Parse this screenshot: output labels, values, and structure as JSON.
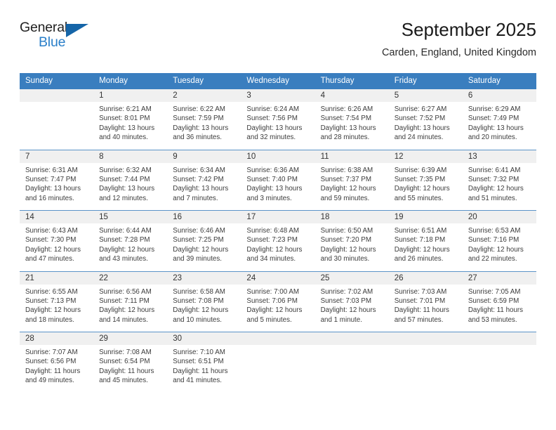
{
  "brand": {
    "name_part1": "General",
    "name_part2": "Blue",
    "flag_icon": "brand-flag-icon",
    "accent_color": "#1565a8"
  },
  "header": {
    "title": "September 2025",
    "location": "Carden, England, United Kingdom"
  },
  "theme": {
    "header_blue": "#3a7ebf",
    "separator_blue": "#5b93c8",
    "daynum_band": "#f0f0f0"
  },
  "columns": [
    "Sunday",
    "Monday",
    "Tuesday",
    "Wednesday",
    "Thursday",
    "Friday",
    "Saturday"
  ],
  "weeks": [
    {
      "days": [
        {
          "num": "",
          "sunrise": "",
          "sunset": "",
          "daylight1": "",
          "daylight2": ""
        },
        {
          "num": "1",
          "sunrise": "Sunrise: 6:21 AM",
          "sunset": "Sunset: 8:01 PM",
          "daylight1": "Daylight: 13 hours",
          "daylight2": "and 40 minutes."
        },
        {
          "num": "2",
          "sunrise": "Sunrise: 6:22 AM",
          "sunset": "Sunset: 7:59 PM",
          "daylight1": "Daylight: 13 hours",
          "daylight2": "and 36 minutes."
        },
        {
          "num": "3",
          "sunrise": "Sunrise: 6:24 AM",
          "sunset": "Sunset: 7:56 PM",
          "daylight1": "Daylight: 13 hours",
          "daylight2": "and 32 minutes."
        },
        {
          "num": "4",
          "sunrise": "Sunrise: 6:26 AM",
          "sunset": "Sunset: 7:54 PM",
          "daylight1": "Daylight: 13 hours",
          "daylight2": "and 28 minutes."
        },
        {
          "num": "5",
          "sunrise": "Sunrise: 6:27 AM",
          "sunset": "Sunset: 7:52 PM",
          "daylight1": "Daylight: 13 hours",
          "daylight2": "and 24 minutes."
        },
        {
          "num": "6",
          "sunrise": "Sunrise: 6:29 AM",
          "sunset": "Sunset: 7:49 PM",
          "daylight1": "Daylight: 13 hours",
          "daylight2": "and 20 minutes."
        }
      ]
    },
    {
      "days": [
        {
          "num": "7",
          "sunrise": "Sunrise: 6:31 AM",
          "sunset": "Sunset: 7:47 PM",
          "daylight1": "Daylight: 13 hours",
          "daylight2": "and 16 minutes."
        },
        {
          "num": "8",
          "sunrise": "Sunrise: 6:32 AM",
          "sunset": "Sunset: 7:44 PM",
          "daylight1": "Daylight: 13 hours",
          "daylight2": "and 12 minutes."
        },
        {
          "num": "9",
          "sunrise": "Sunrise: 6:34 AM",
          "sunset": "Sunset: 7:42 PM",
          "daylight1": "Daylight: 13 hours",
          "daylight2": "and 7 minutes."
        },
        {
          "num": "10",
          "sunrise": "Sunrise: 6:36 AM",
          "sunset": "Sunset: 7:40 PM",
          "daylight1": "Daylight: 13 hours",
          "daylight2": "and 3 minutes."
        },
        {
          "num": "11",
          "sunrise": "Sunrise: 6:38 AM",
          "sunset": "Sunset: 7:37 PM",
          "daylight1": "Daylight: 12 hours",
          "daylight2": "and 59 minutes."
        },
        {
          "num": "12",
          "sunrise": "Sunrise: 6:39 AM",
          "sunset": "Sunset: 7:35 PM",
          "daylight1": "Daylight: 12 hours",
          "daylight2": "and 55 minutes."
        },
        {
          "num": "13",
          "sunrise": "Sunrise: 6:41 AM",
          "sunset": "Sunset: 7:32 PM",
          "daylight1": "Daylight: 12 hours",
          "daylight2": "and 51 minutes."
        }
      ]
    },
    {
      "days": [
        {
          "num": "14",
          "sunrise": "Sunrise: 6:43 AM",
          "sunset": "Sunset: 7:30 PM",
          "daylight1": "Daylight: 12 hours",
          "daylight2": "and 47 minutes."
        },
        {
          "num": "15",
          "sunrise": "Sunrise: 6:44 AM",
          "sunset": "Sunset: 7:28 PM",
          "daylight1": "Daylight: 12 hours",
          "daylight2": "and 43 minutes."
        },
        {
          "num": "16",
          "sunrise": "Sunrise: 6:46 AM",
          "sunset": "Sunset: 7:25 PM",
          "daylight1": "Daylight: 12 hours",
          "daylight2": "and 39 minutes."
        },
        {
          "num": "17",
          "sunrise": "Sunrise: 6:48 AM",
          "sunset": "Sunset: 7:23 PM",
          "daylight1": "Daylight: 12 hours",
          "daylight2": "and 34 minutes."
        },
        {
          "num": "18",
          "sunrise": "Sunrise: 6:50 AM",
          "sunset": "Sunset: 7:20 PM",
          "daylight1": "Daylight: 12 hours",
          "daylight2": "and 30 minutes."
        },
        {
          "num": "19",
          "sunrise": "Sunrise: 6:51 AM",
          "sunset": "Sunset: 7:18 PM",
          "daylight1": "Daylight: 12 hours",
          "daylight2": "and 26 minutes."
        },
        {
          "num": "20",
          "sunrise": "Sunrise: 6:53 AM",
          "sunset": "Sunset: 7:16 PM",
          "daylight1": "Daylight: 12 hours",
          "daylight2": "and 22 minutes."
        }
      ]
    },
    {
      "days": [
        {
          "num": "21",
          "sunrise": "Sunrise: 6:55 AM",
          "sunset": "Sunset: 7:13 PM",
          "daylight1": "Daylight: 12 hours",
          "daylight2": "and 18 minutes."
        },
        {
          "num": "22",
          "sunrise": "Sunrise: 6:56 AM",
          "sunset": "Sunset: 7:11 PM",
          "daylight1": "Daylight: 12 hours",
          "daylight2": "and 14 minutes."
        },
        {
          "num": "23",
          "sunrise": "Sunrise: 6:58 AM",
          "sunset": "Sunset: 7:08 PM",
          "daylight1": "Daylight: 12 hours",
          "daylight2": "and 10 minutes."
        },
        {
          "num": "24",
          "sunrise": "Sunrise: 7:00 AM",
          "sunset": "Sunset: 7:06 PM",
          "daylight1": "Daylight: 12 hours",
          "daylight2": "and 5 minutes."
        },
        {
          "num": "25",
          "sunrise": "Sunrise: 7:02 AM",
          "sunset": "Sunset: 7:03 PM",
          "daylight1": "Daylight: 12 hours",
          "daylight2": "and 1 minute."
        },
        {
          "num": "26",
          "sunrise": "Sunrise: 7:03 AM",
          "sunset": "Sunset: 7:01 PM",
          "daylight1": "Daylight: 11 hours",
          "daylight2": "and 57 minutes."
        },
        {
          "num": "27",
          "sunrise": "Sunrise: 7:05 AM",
          "sunset": "Sunset: 6:59 PM",
          "daylight1": "Daylight: 11 hours",
          "daylight2": "and 53 minutes."
        }
      ]
    },
    {
      "days": [
        {
          "num": "28",
          "sunrise": "Sunrise: 7:07 AM",
          "sunset": "Sunset: 6:56 PM",
          "daylight1": "Daylight: 11 hours",
          "daylight2": "and 49 minutes."
        },
        {
          "num": "29",
          "sunrise": "Sunrise: 7:08 AM",
          "sunset": "Sunset: 6:54 PM",
          "daylight1": "Daylight: 11 hours",
          "daylight2": "and 45 minutes."
        },
        {
          "num": "30",
          "sunrise": "Sunrise: 7:10 AM",
          "sunset": "Sunset: 6:51 PM",
          "daylight1": "Daylight: 11 hours",
          "daylight2": "and 41 minutes."
        },
        {
          "num": "",
          "sunrise": "",
          "sunset": "",
          "daylight1": "",
          "daylight2": ""
        },
        {
          "num": "",
          "sunrise": "",
          "sunset": "",
          "daylight1": "",
          "daylight2": ""
        },
        {
          "num": "",
          "sunrise": "",
          "sunset": "",
          "daylight1": "",
          "daylight2": ""
        },
        {
          "num": "",
          "sunrise": "",
          "sunset": "",
          "daylight1": "",
          "daylight2": ""
        }
      ]
    }
  ]
}
